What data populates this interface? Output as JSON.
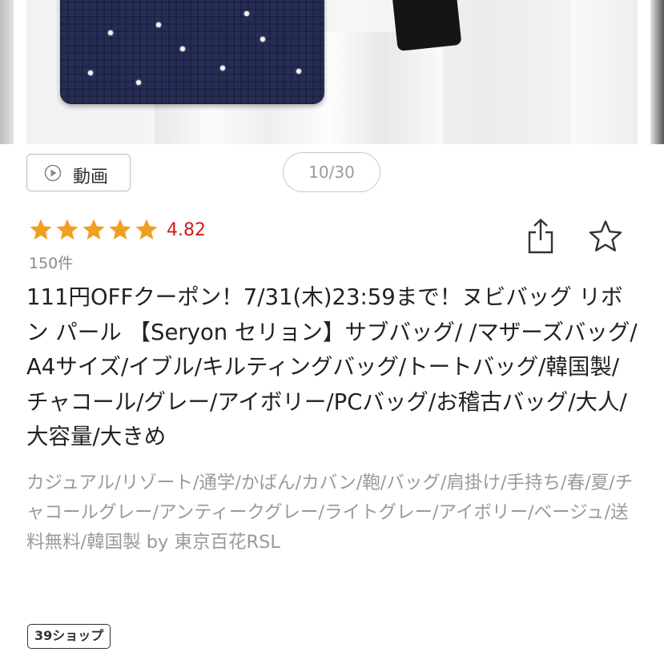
{
  "gallery": {
    "video_label": "動画",
    "counter": "10/30"
  },
  "rating": {
    "stars": 5,
    "value": "4.82",
    "count_label": "150件",
    "star_color": "#f0a020",
    "value_color": "#d31a1a"
  },
  "product": {
    "title": "111円OFFクーポン！7/31(木)23:59まで！ヌビバッグ リボン パール 【Seryon セリョン】サブバッグ/ /マザーズバッグ/A4サイズ/イブル/キルティングバッグ/トートバッグ/韓国製/チャコール/グレー/アイボリー/PCバッグ/お稽古バッグ/大人/大容量/大きめ",
    "tags": "カジュアル/リゾート/通学/かばん/カバン/鞄/バッグ/肩掛け/手持ち/春/夏/チャコールグレー/アンティークグレー/ライトグレー/アイボリー/ベージュ/送料無料/韓国製 by 東京百花RSL",
    "badge": "39ショップ"
  },
  "icons": {
    "share": "share-icon",
    "favorite": "star-outline-icon",
    "play": "play-circle-icon"
  }
}
